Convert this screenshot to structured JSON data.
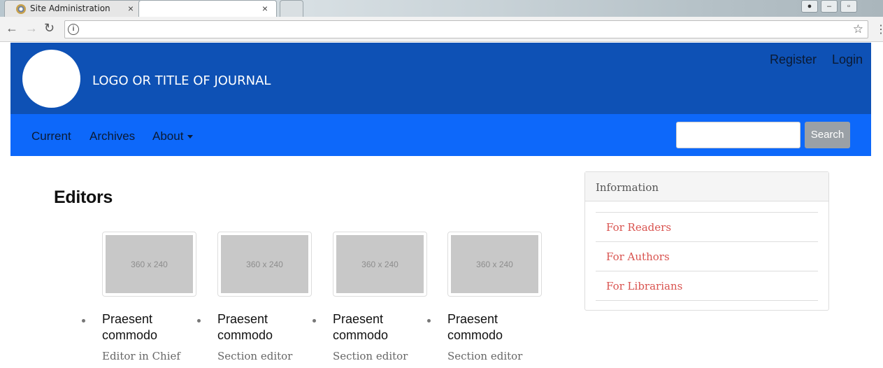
{
  "browser": {
    "tabs": [
      {
        "title": "Site Administration",
        "close": "×"
      },
      {
        "title": "",
        "close": "×"
      }
    ],
    "url": ""
  },
  "header": {
    "site_title": "LOGO OR TITLE OF JOURNAL",
    "register": "Register",
    "login": "Login"
  },
  "nav": {
    "items": [
      "Current",
      "Archives",
      "About"
    ],
    "search_button": "Search",
    "search_value": ""
  },
  "page": {
    "title": "Editors",
    "editors": [
      {
        "image": "360 x 240",
        "name": "Praesent commodo",
        "role": "Editor in Chief"
      },
      {
        "image": "360 x 240",
        "name": "Praesent commodo",
        "role": "Section editor"
      },
      {
        "image": "360 x 240",
        "name": "Praesent commodo",
        "role": "Section editor"
      },
      {
        "image": "360 x 240",
        "name": "Praesent commodo",
        "role": "Section editor"
      }
    ]
  },
  "sidebar": {
    "title": "Information",
    "links": [
      "For Readers",
      "For Authors",
      "For Librarians"
    ]
  }
}
